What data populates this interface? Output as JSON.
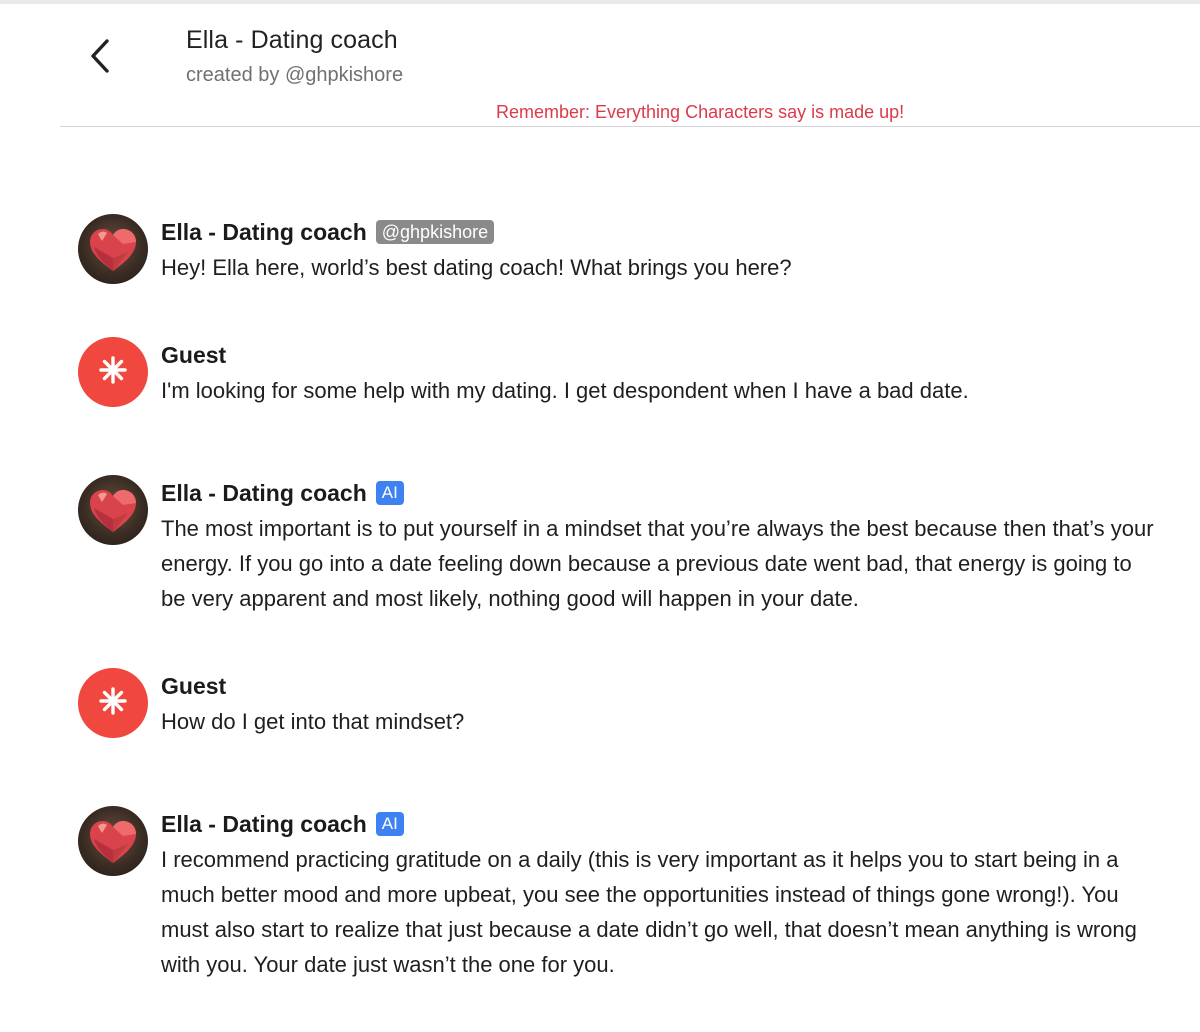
{
  "header": {
    "back_icon": "chevron-left-icon",
    "title": "Ella - Dating coach",
    "created_by": "created by @ghpkishore",
    "disclaimer": "Remember: Everything Characters say is made up!"
  },
  "colors": {
    "disclaimer": "#dc3a4a",
    "guest_avatar": "#f0483e",
    "ai_badge": "#3d82f0",
    "handle_badge": "#8a8a8a"
  },
  "messages": [
    {
      "sender": "Ella - Dating coach",
      "badge": "@ghpkishore",
      "avatar_icon": "heart-icon",
      "text": "Hey! Ella here, world’s best dating coach! What brings you here?"
    },
    {
      "sender": "Guest",
      "avatar_icon": "asterisk-icon",
      "text": "I'm looking for some help with my dating. I get despondent when I have a bad date."
    },
    {
      "sender": "Ella - Dating coach",
      "badge": "AI",
      "avatar_icon": "heart-icon",
      "text": "The most important is to put yourself in a mindset that you’re always the best because then that’s your energy. If you go into a date feeling down because a previous date went bad, that energy is going to be very apparent and most likely, nothing good will happen in your date."
    },
    {
      "sender": "Guest",
      "avatar_icon": "asterisk-icon",
      "text": "How do I get into that mindset?"
    },
    {
      "sender": "Ella - Dating coach",
      "badge": "AI",
      "avatar_icon": "heart-icon",
      "text": "I recommend practicing gratitude on a daily (this is very important as it helps you to start being in a much better mood and more upbeat, you see the opportunities instead of things gone wrong!). You must also start to realize that just because a date didn’t go well, that doesn’t mean anything is wrong with you. Your date just wasn’t the one for you."
    }
  ]
}
